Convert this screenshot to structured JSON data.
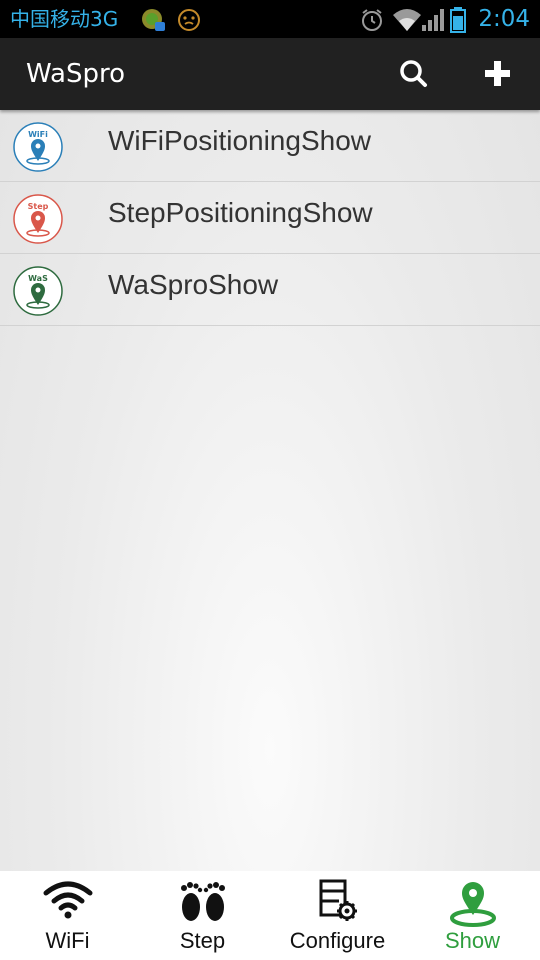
{
  "status_bar": {
    "carrier": "中国移动3G",
    "time": "2:04"
  },
  "action_bar": {
    "title": "WaSpro",
    "actions": [
      "search-icon",
      "add-icon"
    ]
  },
  "list": {
    "items": [
      {
        "label": "WiFiPositioningShow",
        "icon": "wifi-pin-icon",
        "badge": "WiFi",
        "color": "#2a7fb8"
      },
      {
        "label": "StepPositioningShow",
        "icon": "step-pin-icon",
        "badge": "Step",
        "color": "#d9574a"
      },
      {
        "label": "WaSproShow",
        "icon": "waspro-pin-icon",
        "badge": "WaS",
        "color": "#2e6b3f"
      }
    ]
  },
  "bottom_nav": {
    "tabs": [
      {
        "label": "WiFi",
        "icon": "wifi-icon",
        "active": false
      },
      {
        "label": "Step",
        "icon": "footprints-icon",
        "active": false
      },
      {
        "label": "Configure",
        "icon": "configure-icon",
        "active": false
      },
      {
        "label": "Show",
        "icon": "location-pin-icon",
        "active": true
      }
    ],
    "active_color": "#2f9e3e"
  }
}
